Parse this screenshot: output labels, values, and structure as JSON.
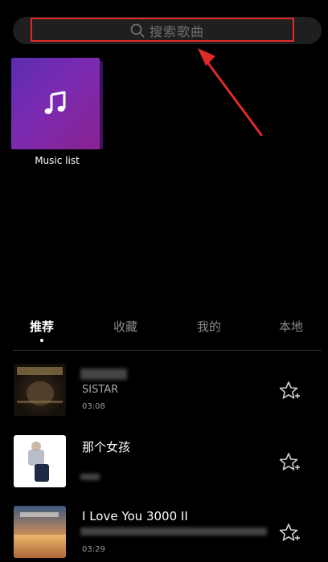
{
  "search": {
    "placeholder": "搜索歌曲"
  },
  "playlist": {
    "label": "Music list"
  },
  "tabs": [
    {
      "label": "推荐",
      "active": true
    },
    {
      "label": "收藏",
      "active": false
    },
    {
      "label": "我的",
      "active": false
    },
    {
      "label": "本地",
      "active": false
    }
  ],
  "songs": [
    {
      "title": "",
      "artist": "SISTAR",
      "duration": "03:08"
    },
    {
      "title": "那个女孩",
      "artist": "",
      "duration": ""
    },
    {
      "title": "I Love You 3000 II",
      "artist": "",
      "duration": "03:29"
    }
  ],
  "colors": {
    "background": "#000000",
    "highlight": "#e02b2b",
    "accent_purple": "#7a2bb2"
  }
}
